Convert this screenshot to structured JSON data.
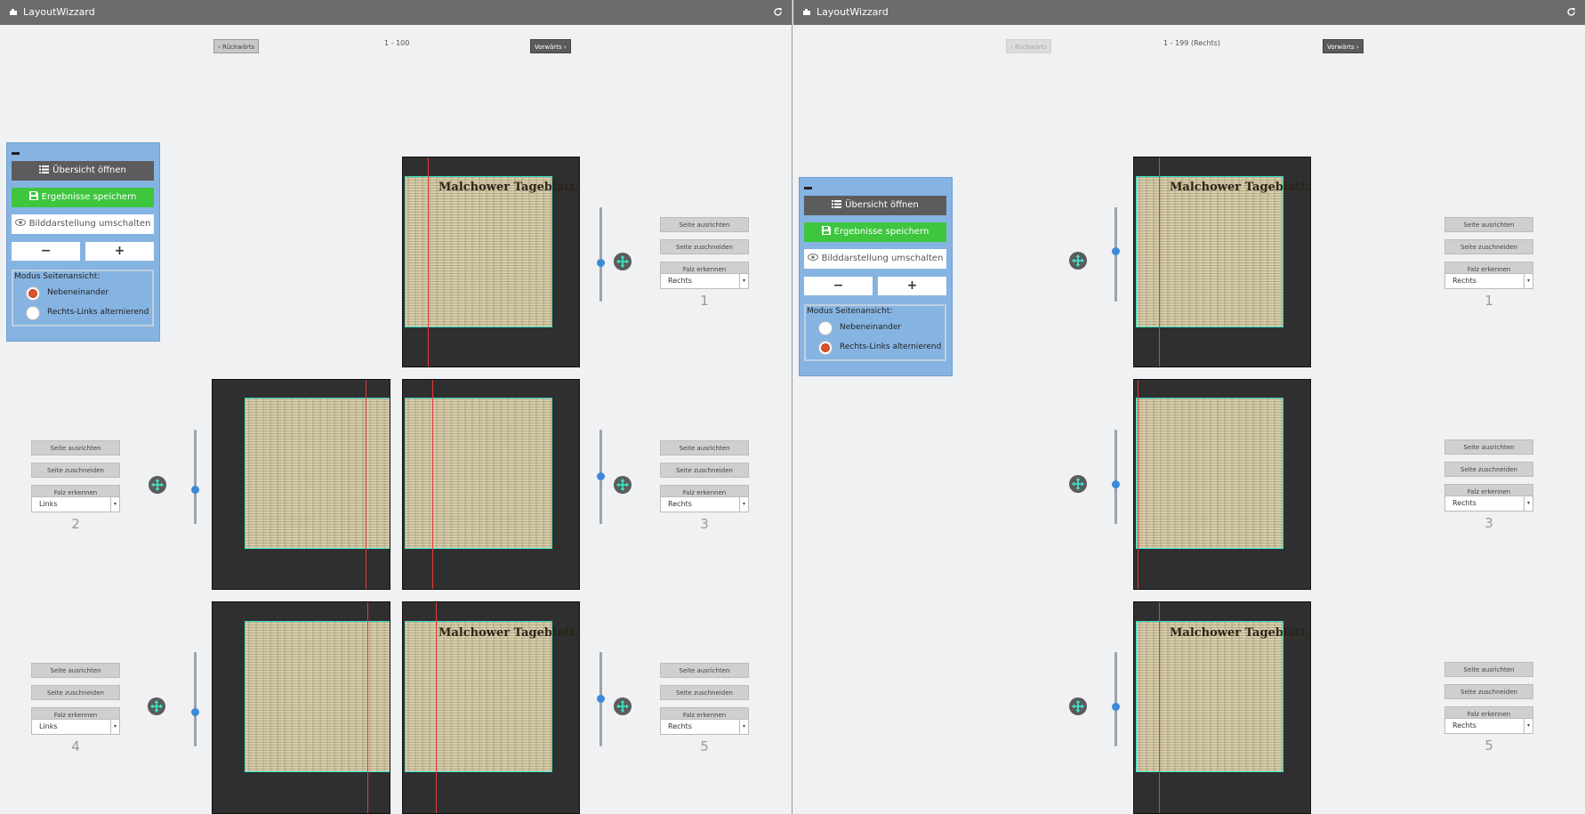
{
  "colors": {
    "titlebar": "#6c6c6c",
    "toolbox": "#86b4e2",
    "save": "#3ec63e",
    "crop": "#37e6c8",
    "fold": "#e23a3a",
    "knob": "#3b8ad8"
  },
  "left": {
    "title": "LayoutWizzard",
    "nav": {
      "prev": "‹ Rückwärts",
      "next": "Vorwärts ›",
      "range": "1 - 100"
    },
    "toolbox": {
      "overview": "Übersicht öffnen",
      "save": "Ergebnisse speichern",
      "toggle": "Bilddarstellung umschalten",
      "zoom_out": "−",
      "zoom_in": "+",
      "mode_label": "Modus Seitenansicht:",
      "mode_side": "Nebeneinander",
      "mode_alt": "Rechts-Links alternierend",
      "selected_mode": "Nebeneinander"
    },
    "pages": [
      {
        "num": "1",
        "side": "Rechts",
        "masthead": "Malchower Tageblatt."
      },
      {
        "num": "2",
        "side": "Links",
        "masthead": ""
      },
      {
        "num": "3",
        "side": "Rechts",
        "masthead": ""
      },
      {
        "num": "4",
        "side": "Links",
        "masthead": ""
      },
      {
        "num": "5",
        "side": "Rechts",
        "masthead": "Malchower Tageblatt."
      }
    ],
    "controls": {
      "align": "Seite ausrichten",
      "crop": "Seite zuschneiden",
      "fold": "Falz erkennen"
    }
  },
  "right": {
    "title": "LayoutWizzard",
    "nav": {
      "prev": "‹ Rückwärts",
      "next": "Vorwärts ›",
      "range": "1 - 199 (Rechts)",
      "prev_disabled": true
    },
    "toolbox": {
      "overview": "Übersicht öffnen",
      "save": "Ergebnisse speichern",
      "toggle": "Bilddarstellung umschalten",
      "zoom_out": "−",
      "zoom_in": "+",
      "mode_label": "Modus Seitenansicht:",
      "mode_side": "Nebeneinander",
      "mode_alt": "Rechts-Links alternierend",
      "selected_mode": "Rechts-Links alternierend"
    },
    "pages": [
      {
        "num": "1",
        "side": "Rechts",
        "masthead": "Malchower Tageblatt."
      },
      {
        "num": "3",
        "side": "Rechts",
        "masthead": ""
      },
      {
        "num": "5",
        "side": "Rechts",
        "masthead": "Malchower Tageblatt."
      }
    ],
    "controls": {
      "align": "Seite ausrichten",
      "crop": "Seite zuschneiden",
      "fold": "Falz erkennen"
    }
  }
}
